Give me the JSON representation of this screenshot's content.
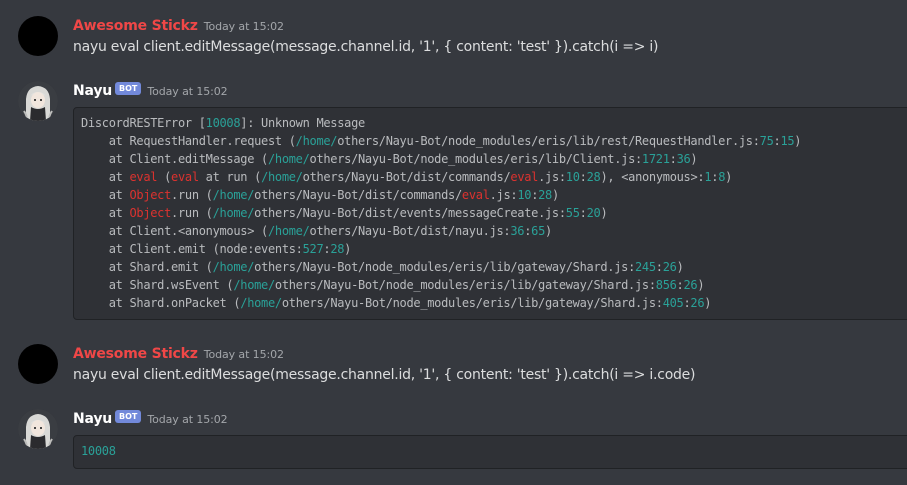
{
  "colors": {
    "background": "#36393f",
    "codeblock_bg": "#2f3136",
    "user_red": "#f04747",
    "bot_tag": "#7289da",
    "number_teal": "#2aa198",
    "keyword_red": "#dc322f"
  },
  "messages": [
    {
      "author": "Awesome Stickz",
      "timestamp": "Today at 15:02",
      "text": "nayu eval client.editMessage(message.channel.id, '1', { content: 'test' }).catch(i => i)"
    },
    {
      "author": "Nayu",
      "bot_tag": "BOT",
      "timestamp": "Today at 15:02",
      "code_lines": [
        [
          {
            "t": "DiscordRESTError ["
          },
          {
            "t": "10008",
            "c": "num"
          },
          {
            "t": "]: Unknown Message"
          }
        ],
        [
          {
            "t": "    at RequestHandler.request ("
          },
          {
            "t": "/home/",
            "c": "num"
          },
          {
            "t": "others/Nayu-Bot/node_modules/eris/lib/rest/RequestHandler.js:"
          },
          {
            "t": "75",
            "c": "num"
          },
          {
            "t": ":"
          },
          {
            "t": "15",
            "c": "num"
          },
          {
            "t": ")"
          }
        ],
        [
          {
            "t": "    at Client.editMessage ("
          },
          {
            "t": "/home/",
            "c": "num"
          },
          {
            "t": "others/Nayu-Bot/node_modules/eris/lib/Client.js:"
          },
          {
            "t": "1721",
            "c": "num"
          },
          {
            "t": ":"
          },
          {
            "t": "36",
            "c": "num"
          },
          {
            "t": ")"
          }
        ],
        [
          {
            "t": "    at "
          },
          {
            "t": "eval",
            "c": "ident"
          },
          {
            "t": " ("
          },
          {
            "t": "eval",
            "c": "ident"
          },
          {
            "t": " at run ("
          },
          {
            "t": "/home/",
            "c": "num"
          },
          {
            "t": "others/Nayu-Bot/dist/commands/"
          },
          {
            "t": "eval",
            "c": "ident"
          },
          {
            "t": ".js:"
          },
          {
            "t": "10",
            "c": "num"
          },
          {
            "t": ":"
          },
          {
            "t": "28",
            "c": "num"
          },
          {
            "t": "), <anonymous>:"
          },
          {
            "t": "1",
            "c": "num"
          },
          {
            "t": ":"
          },
          {
            "t": "8",
            "c": "num"
          },
          {
            "t": ")"
          }
        ],
        [
          {
            "t": "    at "
          },
          {
            "t": "Object",
            "c": "ident"
          },
          {
            "t": ".run ("
          },
          {
            "t": "/home/",
            "c": "num"
          },
          {
            "t": "others/Nayu-Bot/dist/commands/"
          },
          {
            "t": "eval",
            "c": "ident"
          },
          {
            "t": ".js:"
          },
          {
            "t": "10",
            "c": "num"
          },
          {
            "t": ":"
          },
          {
            "t": "28",
            "c": "num"
          },
          {
            "t": ")"
          }
        ],
        [
          {
            "t": "    at "
          },
          {
            "t": "Object",
            "c": "ident"
          },
          {
            "t": ".run ("
          },
          {
            "t": "/home/",
            "c": "num"
          },
          {
            "t": "others/Nayu-Bot/dist/events/messageCreate.js:"
          },
          {
            "t": "55",
            "c": "num"
          },
          {
            "t": ":"
          },
          {
            "t": "20",
            "c": "num"
          },
          {
            "t": ")"
          }
        ],
        [
          {
            "t": "    at Client.<anonymous> ("
          },
          {
            "t": "/home/",
            "c": "num"
          },
          {
            "t": "others/Nayu-Bot/dist/nayu.js:"
          },
          {
            "t": "36",
            "c": "num"
          },
          {
            "t": ":"
          },
          {
            "t": "65",
            "c": "num"
          },
          {
            "t": ")"
          }
        ],
        [
          {
            "t": "    at Client.emit (node:events:"
          },
          {
            "t": "527",
            "c": "num"
          },
          {
            "t": ":"
          },
          {
            "t": "28",
            "c": "num"
          },
          {
            "t": ")"
          }
        ],
        [
          {
            "t": "    at Shard.emit ("
          },
          {
            "t": "/home/",
            "c": "num"
          },
          {
            "t": "others/Nayu-Bot/node_modules/eris/lib/gateway/Shard.js:"
          },
          {
            "t": "245",
            "c": "num"
          },
          {
            "t": ":"
          },
          {
            "t": "26",
            "c": "num"
          },
          {
            "t": ")"
          }
        ],
        [
          {
            "t": "    at Shard.wsEvent ("
          },
          {
            "t": "/home/",
            "c": "num"
          },
          {
            "t": "others/Nayu-Bot/node_modules/eris/lib/gateway/Shard.js:"
          },
          {
            "t": "856",
            "c": "num"
          },
          {
            "t": ":"
          },
          {
            "t": "26",
            "c": "num"
          },
          {
            "t": ")"
          }
        ],
        [
          {
            "t": "    at Shard.onPacket ("
          },
          {
            "t": "/home/",
            "c": "num"
          },
          {
            "t": "others/Nayu-Bot/node_modules/eris/lib/gateway/Shard.js:"
          },
          {
            "t": "405",
            "c": "num"
          },
          {
            "t": ":"
          },
          {
            "t": "26",
            "c": "num"
          },
          {
            "t": ")"
          }
        ]
      ]
    },
    {
      "author": "Awesome Stickz",
      "timestamp": "Today at 15:02",
      "text": "nayu eval client.editMessage(message.channel.id, '1', { content: 'test' }).catch(i => i.code)"
    },
    {
      "author": "Nayu",
      "bot_tag": "BOT",
      "timestamp": "Today at 15:02",
      "code_lines": [
        [
          {
            "t": "10008",
            "c": "num"
          }
        ]
      ]
    }
  ]
}
